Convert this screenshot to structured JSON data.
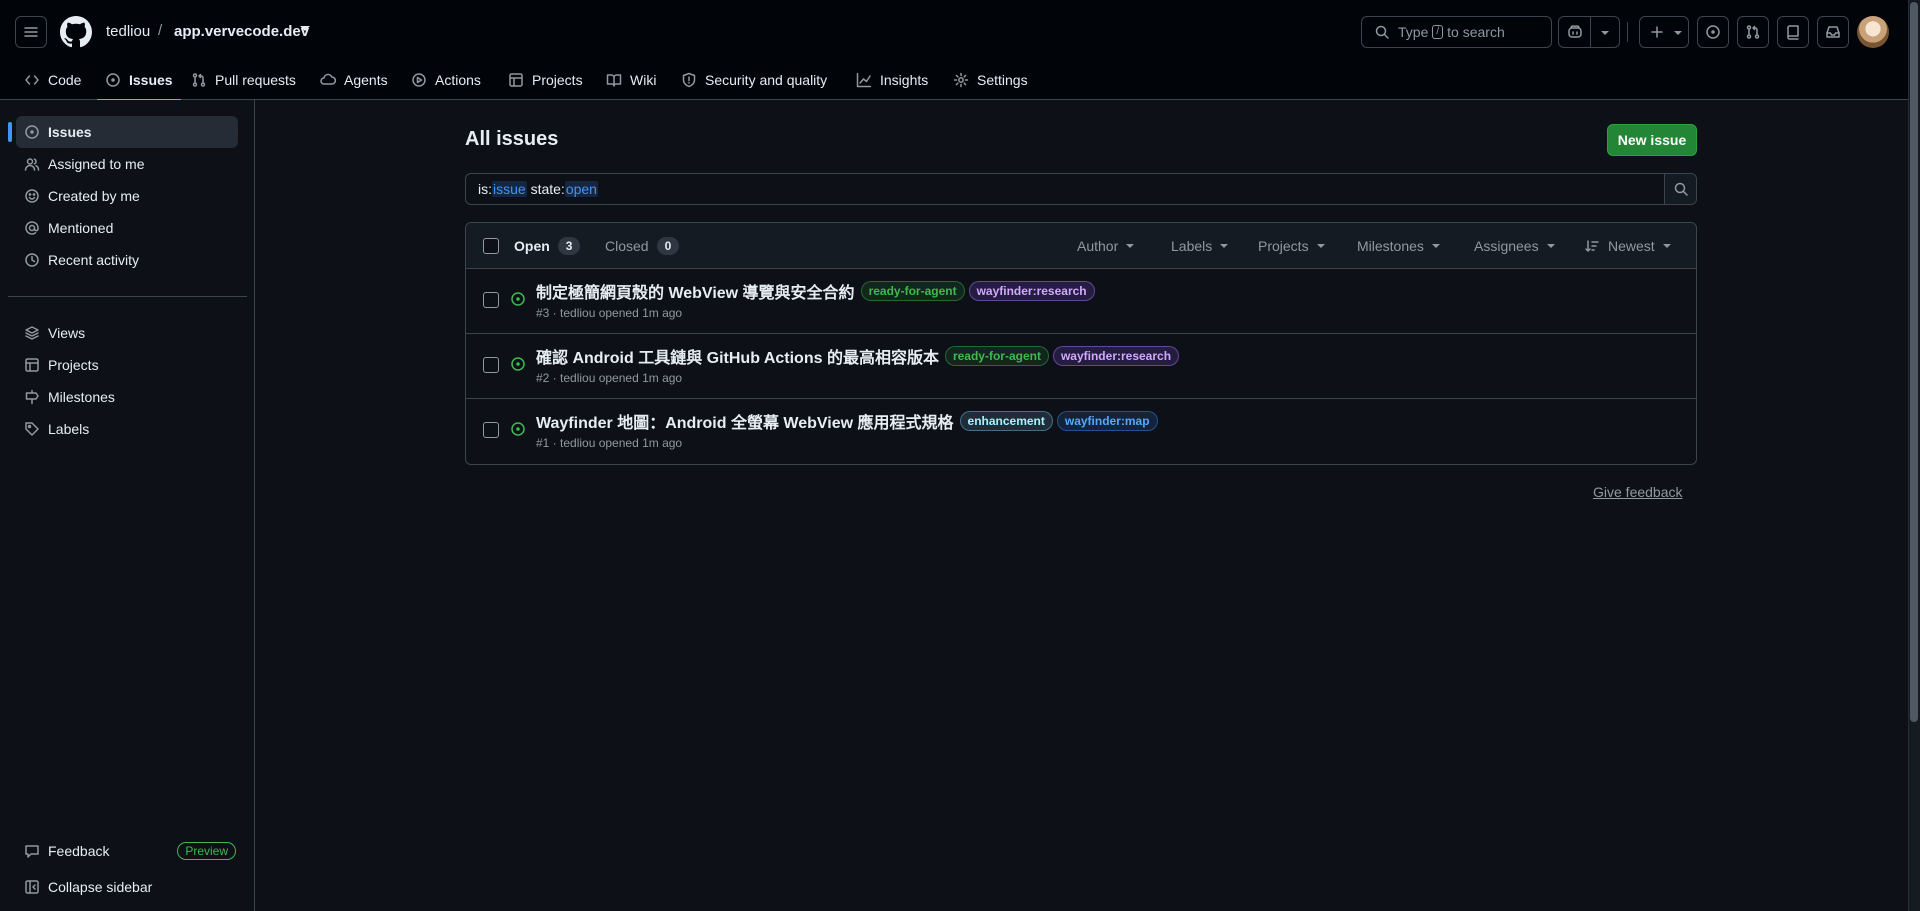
{
  "header": {
    "owner": "tedliou",
    "separator": "/",
    "repo": "app.vervecode.dev",
    "search_prefix": "Type",
    "search_key": "/",
    "search_suffix": "to search"
  },
  "nav": {
    "tabs": [
      {
        "label": "Code",
        "icon": "code-icon"
      },
      {
        "label": "Issues",
        "icon": "issue-opened-icon",
        "selected": true
      },
      {
        "label": "Pull requests",
        "icon": "git-pull-request-icon"
      },
      {
        "label": "Agents",
        "icon": "agent-icon"
      },
      {
        "label": "Actions",
        "icon": "play-icon"
      },
      {
        "label": "Projects",
        "icon": "table-icon"
      },
      {
        "label": "Wiki",
        "icon": "book-icon"
      },
      {
        "label": "Security and quality",
        "icon": "shield-icon"
      },
      {
        "label": "Insights",
        "icon": "graph-icon"
      },
      {
        "label": "Settings",
        "icon": "gear-icon"
      }
    ]
  },
  "sidebar": {
    "items": [
      {
        "label": "Issues",
        "icon": "issue-opened-icon",
        "selected": true
      },
      {
        "label": "Assigned to me",
        "icon": "people-icon"
      },
      {
        "label": "Created by me",
        "icon": "smiley-icon"
      },
      {
        "label": "Mentioned",
        "icon": "mention-icon"
      },
      {
        "label": "Recent activity",
        "icon": "clock-icon"
      }
    ],
    "items2": [
      {
        "label": "Views",
        "icon": "stack-icon"
      },
      {
        "label": "Projects",
        "icon": "table-icon"
      },
      {
        "label": "Milestones",
        "icon": "milestone-icon"
      },
      {
        "label": "Labels",
        "icon": "tag-icon"
      }
    ],
    "feedback": "Feedback",
    "preview_badge": "Preview",
    "collapse": "Collapse sidebar"
  },
  "main": {
    "title": "All issues",
    "new_issue": "New issue",
    "query": {
      "k1": "is:",
      "v1": "issue",
      "k2": "state:",
      "v2": "open"
    },
    "open_label": "Open",
    "open_count": "3",
    "closed_label": "Closed",
    "closed_count": "0",
    "filters": [
      "Author",
      "Labels",
      "Projects",
      "Milestones",
      "Assignees",
      "Newest"
    ],
    "issues": [
      {
        "title": "制定極簡網頁殼的 WebView 導覽與安全合約",
        "labels": [
          {
            "text": "ready-for-agent",
            "color": "green"
          },
          {
            "text": "wayfinder:research",
            "color": "purple"
          }
        ],
        "meta": "#3 · tedliou opened 1m ago"
      },
      {
        "title": "確認 Android 工具鏈與 GitHub Actions 的最高相容版本",
        "labels": [
          {
            "text": "ready-for-agent",
            "color": "green"
          },
          {
            "text": "wayfinder:research",
            "color": "purple"
          }
        ],
        "meta": "#2 · tedliou opened 1m ago"
      },
      {
        "title": "Wayfinder 地圖：Android 全螢幕 WebView 應用程式規格",
        "labels": [
          {
            "text": "enhancement",
            "color": "teal"
          },
          {
            "text": "wayfinder:map",
            "color": "blue"
          }
        ],
        "meta": "#1 · tedliou opened 1m ago"
      }
    ],
    "give_feedback": "Give feedback"
  },
  "colors": {
    "accent": "#4493f8",
    "primary_button": "#238636",
    "selected_tab_underline": "#f78166",
    "open_issue": "#3fb950"
  }
}
